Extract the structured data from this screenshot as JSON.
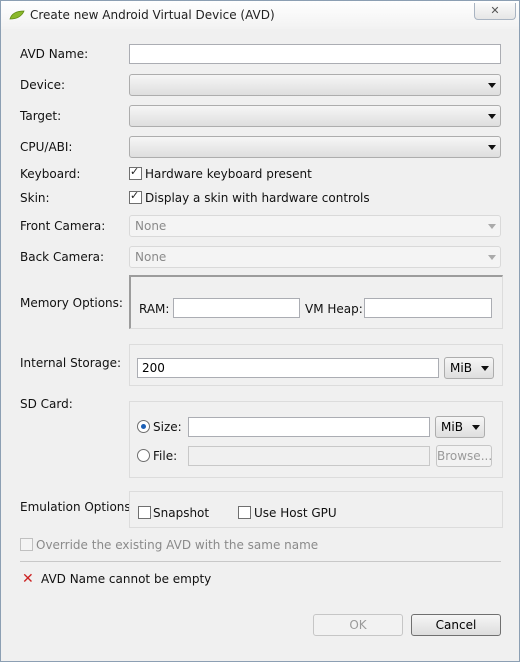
{
  "window": {
    "title": "Create new Android Virtual Device (AVD)",
    "close_glyph": "✕"
  },
  "form": {
    "avd_name_label": "AVD Name:",
    "avd_name_value": "",
    "device_label": "Device:",
    "device_value": "",
    "target_label": "Target:",
    "target_value": "",
    "cpu_label": "CPU/ABI:",
    "cpu_value": "",
    "keyboard_label": "Keyboard:",
    "keyboard_check_label": "Hardware keyboard present",
    "skin_label": "Skin:",
    "skin_check_label": "Display a skin with hardware controls",
    "front_camera_label": "Front Camera:",
    "front_camera_value": "None",
    "back_camera_label": "Back Camera:",
    "back_camera_value": "None",
    "memory_label": "Memory Options:",
    "ram_label": "RAM:",
    "ram_value": "",
    "vmheap_label": "VM Heap:",
    "vmheap_value": "",
    "internal_storage_label": "Internal Storage:",
    "internal_storage_value": "200",
    "internal_storage_unit": "MiB",
    "sdcard_label": "SD Card:",
    "sd_size_label": "Size:",
    "sd_size_value": "",
    "sd_size_unit": "MiB",
    "sd_file_label": "File:",
    "sd_file_value": "",
    "browse_label": "Browse...",
    "emulation_label": "Emulation Options:",
    "snapshot_label": "Snapshot",
    "host_gpu_label": "Use Host GPU",
    "override_label": "Override the existing AVD with the same name",
    "error_message": "AVD Name cannot be empty",
    "ok_label": "OK",
    "cancel_label": "Cancel"
  },
  "state": {
    "keyboard_checked": true,
    "skin_checked": true,
    "sd_option_selected": "size",
    "snapshot_checked": false,
    "host_gpu_checked": false,
    "override_checked": false
  },
  "colors": {
    "error": "#cc2222",
    "radio_dot": "#1c5fb5",
    "app_icon": "#8ab82a"
  }
}
